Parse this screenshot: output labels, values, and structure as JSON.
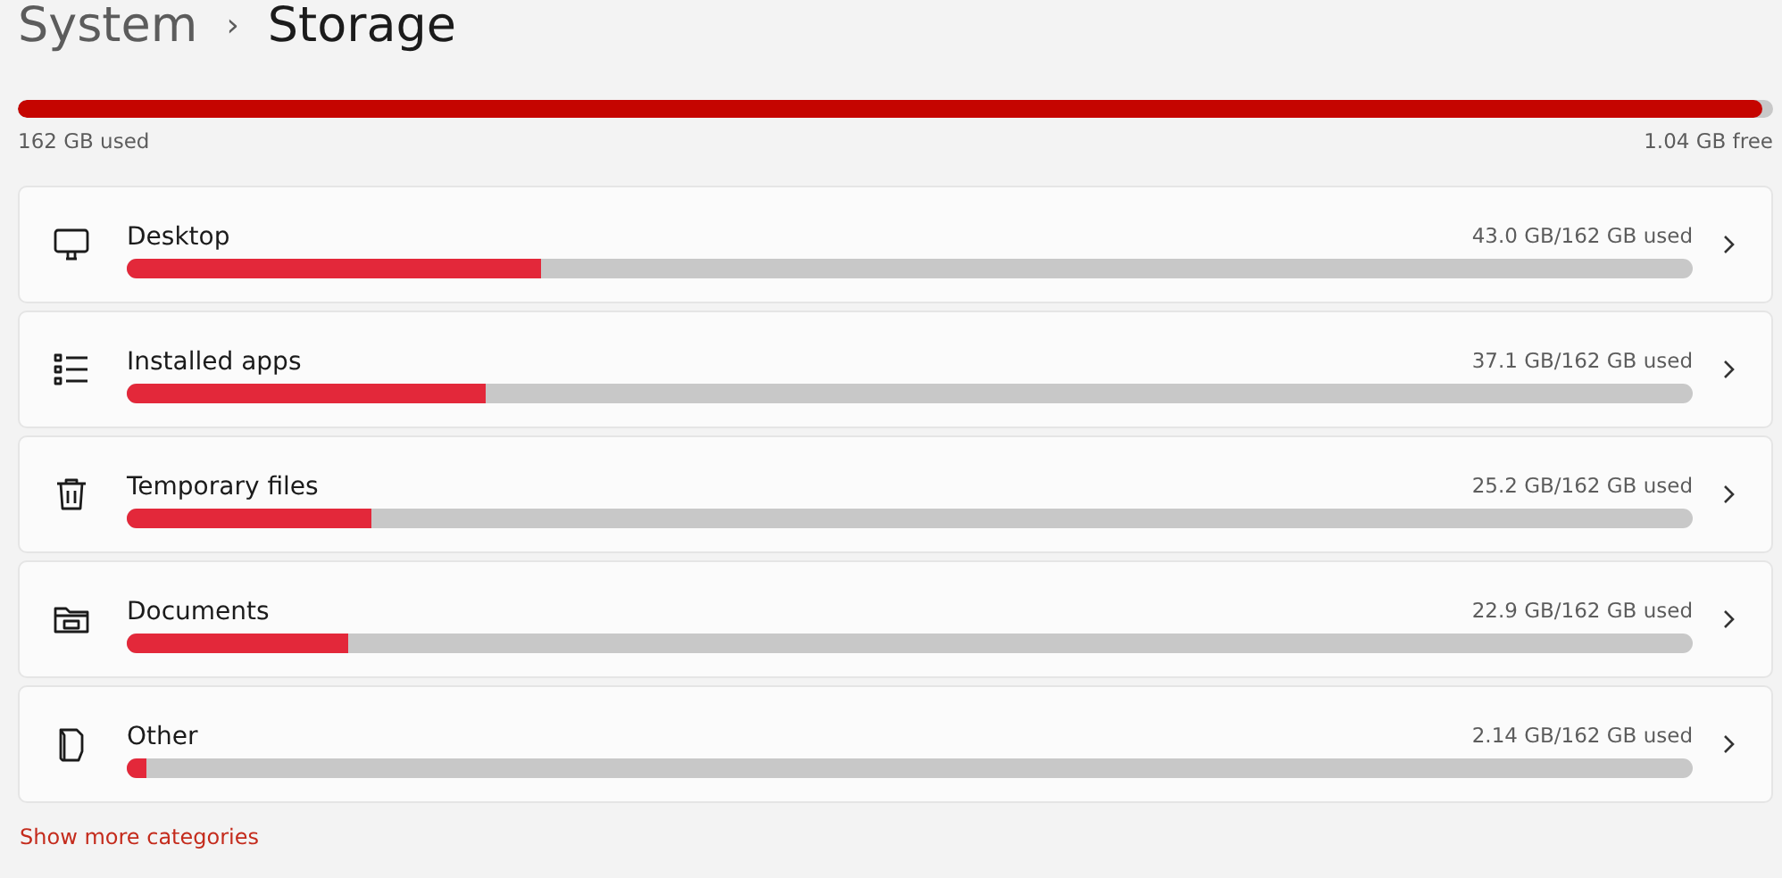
{
  "breadcrumb": [
    {
      "label": "System",
      "current": false
    },
    {
      "label": "›",
      "kind": "separator"
    },
    {
      "label": "Storage",
      "current": true
    }
  ],
  "drive": {
    "level": 0.994,
    "used": "162 GB used",
    "free": "1.04 GB free"
  },
  "categories": [
    {
      "name": "Desktop",
      "kind": "monitor",
      "reading": "43.0 GB/162 GB used",
      "level": 0.265
    },
    {
      "name": "Installed apps",
      "kind": "list",
      "reading": "37.1 GB/162 GB used",
      "level": 0.229
    },
    {
      "name": "Temporary files",
      "kind": "trash",
      "reading": "25.2 GB/162 GB used",
      "level": 0.156
    },
    {
      "name": "Documents",
      "kind": "folder",
      "reading": "22.9 GB/162 GB used",
      "level": 0.141
    },
    {
      "name": "Other",
      "kind": "file",
      "reading": "2.14 GB/162 GB used",
      "level": 0.013
    }
  ],
  "show_more": "Show more categories"
}
